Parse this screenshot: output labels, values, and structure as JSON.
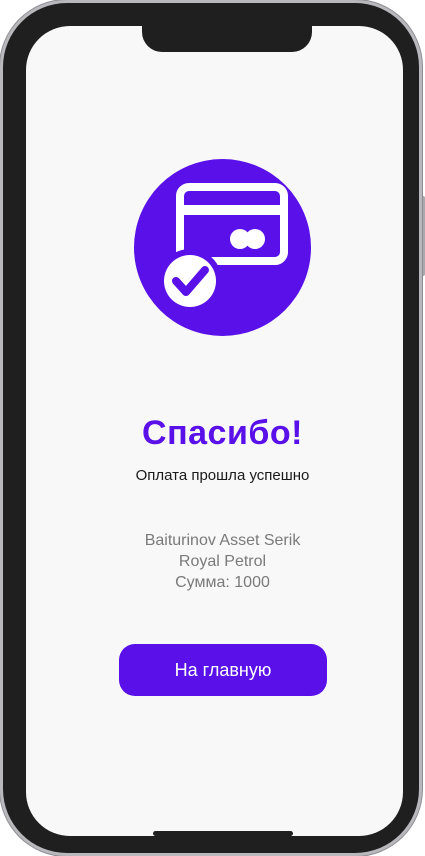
{
  "success": {
    "title": "Спасибо!",
    "subtitle": "Оплата прошла успешно"
  },
  "details": {
    "name": "Baiturinov Asset Serik",
    "company": "Royal Petrol",
    "amount": "Сумма: 1000"
  },
  "actions": {
    "home_label": "На главную"
  },
  "icon": {
    "name": "card-payment-success-icon",
    "accent": "#5a10e8"
  },
  "colors": {
    "accent": "#5a10e8",
    "screen_background": "#f8f8f8",
    "secondary_text": "#7a7a7a"
  }
}
